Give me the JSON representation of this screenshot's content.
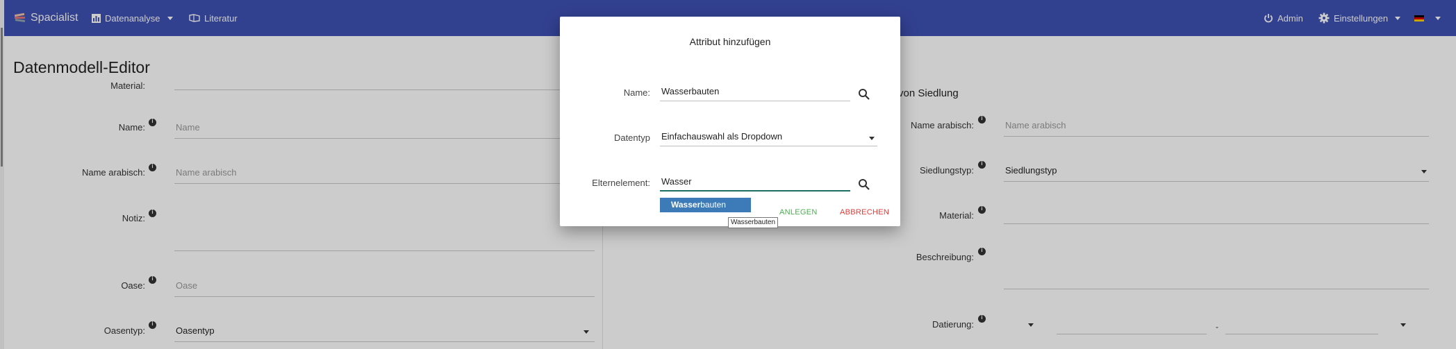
{
  "navbar": {
    "brand": "Spacialist",
    "datenanalyse": "Datenanalyse",
    "literatur": "Literatur",
    "admin": "Admin",
    "einstellungen": "Einstellungen",
    "accent_color": "#3f51b5"
  },
  "page": {
    "title": "Datenmodell-Editor"
  },
  "left_form": {
    "rows": [
      {
        "label": "Material:",
        "value": ""
      },
      {
        "label": "Name:",
        "placeholder": "Name"
      },
      {
        "label": "Name arabisch:",
        "placeholder": "Name arabisch"
      },
      {
        "label": "Notiz:",
        "value": ""
      },
      {
        "label": "Oase:",
        "placeholder": "Oase"
      },
      {
        "label": "Oasentyp:",
        "value": "Oasentyp"
      }
    ]
  },
  "right_form": {
    "heading_fragment": "von Siedlung",
    "rows": [
      {
        "label": "Name arabisch:",
        "placeholder": "Name arabisch"
      },
      {
        "label": "Siedlungstyp:",
        "value": "Siedlungstyp"
      },
      {
        "label": "Material:",
        "value": ""
      },
      {
        "label": "Beschreibung:",
        "value": ""
      },
      {
        "label": "Datierung:",
        "separator": "-"
      }
    ]
  },
  "modal": {
    "title": "Attribut hinzufügen",
    "name_label": "Name:",
    "name_value": "Wasserbauten",
    "datatype_label": "Datentyp",
    "datatype_value": "Einfachauswahl als Dropdown",
    "parent_label": "Elternelement:",
    "parent_value": "Wasser",
    "suggestion_match": "Wasser",
    "suggestion_rest": "bauten",
    "create_label": "ANLEGEN",
    "cancel_label": "ABBRECHEN",
    "tooltip": "Wasserbauten"
  },
  "icons": {
    "brand": "spacialist-logo-icon",
    "datenanalyse": "bar-chart-icon",
    "literatur": "book-icon",
    "admin": "power-icon",
    "einstellungen": "gear-icon",
    "language": "german-flag-icon",
    "search": "search-icon",
    "info": "info-icon"
  }
}
